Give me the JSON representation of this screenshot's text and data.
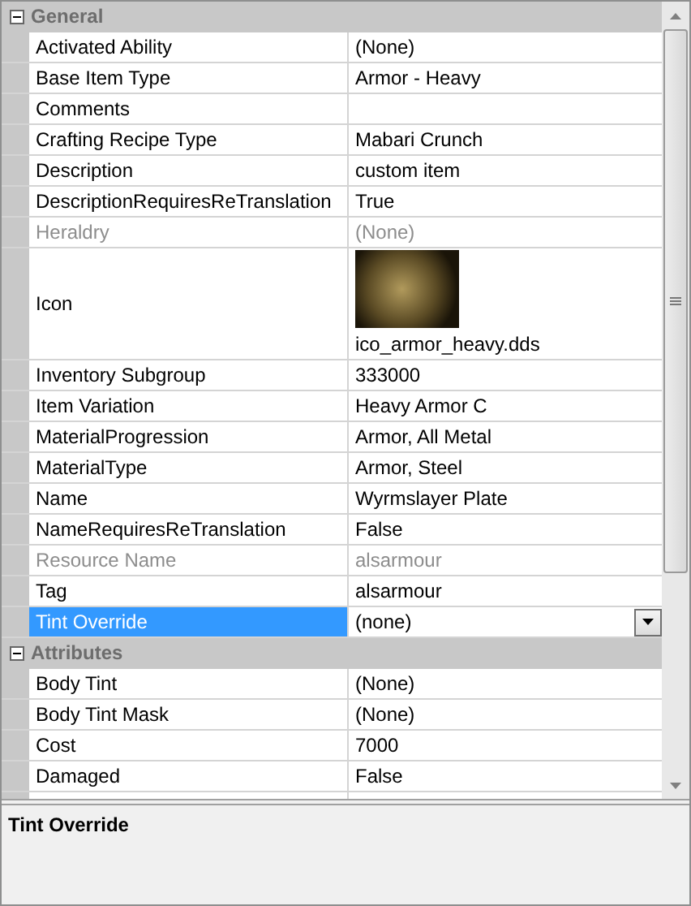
{
  "categories": [
    {
      "title": "General",
      "expanded": true,
      "rows": [
        {
          "name": "Activated Ability",
          "value": "(None)",
          "kind": "text",
          "disabled": false,
          "selected": false
        },
        {
          "name": "Base Item Type",
          "value": "Armor - Heavy",
          "kind": "text",
          "disabled": false,
          "selected": false
        },
        {
          "name": "Comments",
          "kind": "text",
          "disabled": false,
          "selected": false
        },
        {
          "name": "Crafting Recipe Type",
          "value": "Mabari Crunch",
          "kind": "text",
          "disabled": false,
          "selected": false
        },
        {
          "name": "Description",
          "value": "custom item",
          "kind": "text",
          "disabled": false,
          "selected": false
        },
        {
          "name": "DescriptionRequiresReTranslation",
          "value": "True",
          "kind": "text",
          "disabled": false,
          "selected": false
        },
        {
          "name": "Heraldry",
          "value": "(None)",
          "kind": "text",
          "disabled": true,
          "selected": false
        },
        {
          "name": "Icon",
          "value": "ico_armor_heavy.dds",
          "kind": "image",
          "disabled": false,
          "selected": false
        },
        {
          "name": "Inventory Subgroup",
          "value": "333000",
          "kind": "text",
          "disabled": false,
          "selected": false
        },
        {
          "name": "Item Variation",
          "value": "Heavy Armor C",
          "kind": "text",
          "disabled": false,
          "selected": false
        },
        {
          "name": "MaterialProgression",
          "value": "Armor, All Metal",
          "kind": "text",
          "disabled": false,
          "selected": false
        },
        {
          "name": "MaterialType",
          "value": "Armor, Steel",
          "kind": "text",
          "disabled": false,
          "selected": false
        },
        {
          "name": "Name",
          "value": "Wyrmslayer Plate",
          "kind": "text",
          "disabled": false,
          "selected": false
        },
        {
          "name": "NameRequiresReTranslation",
          "value": "False",
          "kind": "text",
          "disabled": false,
          "selected": false
        },
        {
          "name": "Resource Name",
          "value": "alsarmour",
          "kind": "text",
          "disabled": true,
          "selected": false
        },
        {
          "name": "Tag",
          "value": "alsarmour",
          "kind": "text",
          "disabled": false,
          "selected": false
        },
        {
          "name": "Tint Override",
          "value": "(none)",
          "kind": "dropdown",
          "disabled": false,
          "selected": true
        }
      ]
    },
    {
      "title": "Attributes",
      "expanded": true,
      "rows": [
        {
          "name": "Body Tint",
          "value": "(None)",
          "kind": "text",
          "disabled": false,
          "selected": false
        },
        {
          "name": "Body Tint Mask",
          "value": "(None)",
          "kind": "text",
          "disabled": false,
          "selected": false
        },
        {
          "name": "Cost",
          "value": "7000",
          "kind": "text",
          "disabled": false,
          "selected": false
        },
        {
          "name": "Damaged",
          "value": "False",
          "kind": "text",
          "disabled": false,
          "selected": false
        },
        {
          "kind": "text",
          "disabled": false,
          "selected": false
        }
      ]
    }
  ],
  "help": {
    "title": "Tint Override"
  }
}
